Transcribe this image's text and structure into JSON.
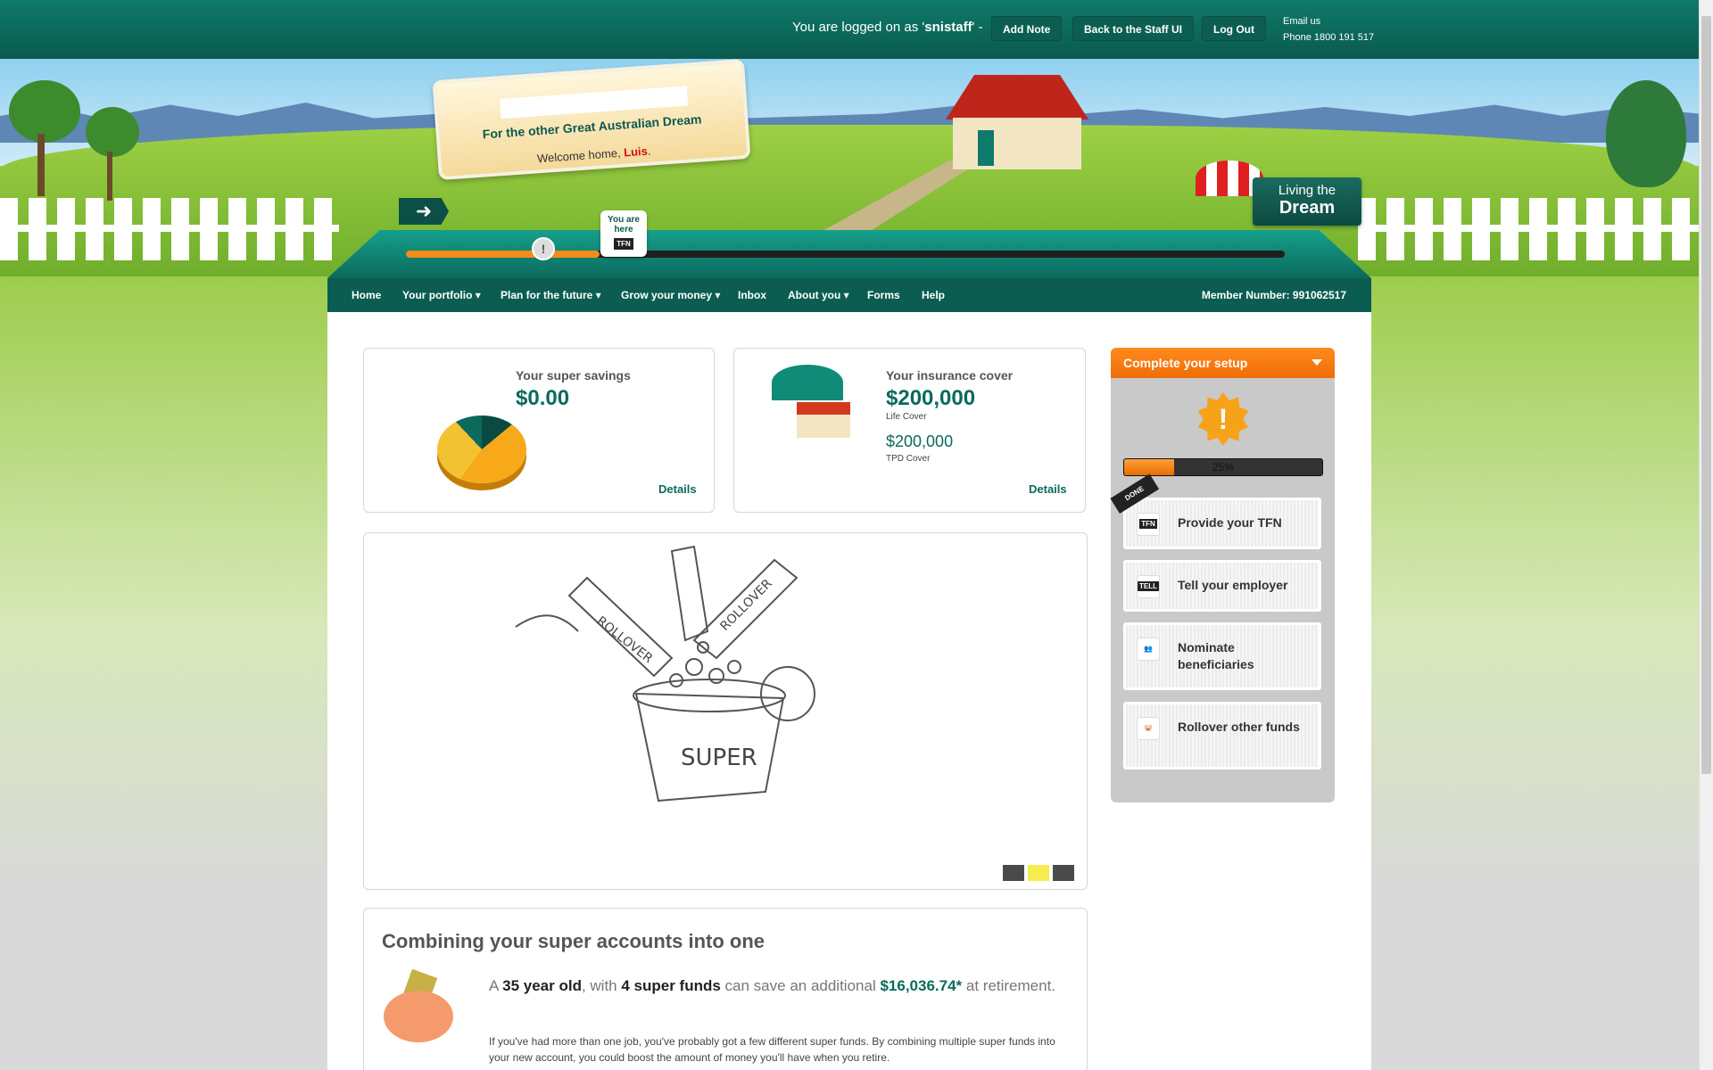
{
  "topbar": {
    "logged_prefix": "You are logged on as '",
    "username": "snistaff",
    "logged_suffix": "' -",
    "add_note": "Add Note",
    "back_staff": "Back to the Staff UI",
    "logout": "Log Out",
    "email": "Email us",
    "phone": "Phone 1800 191 517"
  },
  "hero": {
    "slogan": "For the other Great Australian Dream",
    "welcome_prefix": "Welcome home, ",
    "name": "Luis",
    "welcome_suffix": ".",
    "you_are_here": "You are here",
    "you_are_here_icon": "TFN",
    "dream_line1": "Living the",
    "dream_line2": "Dream",
    "journey_progress": 0.22
  },
  "nav": {
    "items": [
      {
        "label": "Home"
      },
      {
        "label": "Your portfolio ▾"
      },
      {
        "label": "Plan for the future ▾"
      },
      {
        "label": "Grow your money ▾"
      },
      {
        "label": "Inbox"
      },
      {
        "label": "About you ▾"
      },
      {
        "label": "Forms"
      },
      {
        "label": "Help"
      }
    ],
    "member": "Member Number: 991062517"
  },
  "super": {
    "title": "Your super savings",
    "amount": "$0.00",
    "details": "Details"
  },
  "insurance": {
    "title": "Your insurance cover",
    "life_amount": "$200,000",
    "life_label": "Life Cover",
    "tpd_amount": "$200,000",
    "tpd_label": "TPD Cover",
    "details": "Details"
  },
  "slider": {
    "sketch_text": [
      "ROLLOVER",
      "ROLLOVER",
      "SUPER"
    ],
    "active_index": 1
  },
  "combine": {
    "title": "Combining your super accounts into one",
    "stat_a": "A ",
    "stat_age": "35 year old",
    "stat_with": ", with ",
    "stat_funds": "4 super funds",
    "stat_save": " can save an additional ",
    "stat_money": "$16,036.74*",
    "stat_end": " at retirement.",
    "para": "If you've had more than one job, you've probably got a few different super funds. By combining multiple super funds into your new                    account, you could boost the amount of money you'll have when you retire."
  },
  "setup": {
    "title": "Complete your setup",
    "progress_label": "25%",
    "progress": 0.25,
    "done_label": "DONE",
    "steps": [
      {
        "label": "Provide your TFN",
        "icon": "TFN"
      },
      {
        "label": "Tell your employer",
        "icon": "TELL"
      },
      {
        "label": "Nominate beneficiaries",
        "icon": "people-icon"
      },
      {
        "label": "Rollover other funds",
        "icon": "piggy-icon"
      }
    ]
  },
  "colors": {
    "brand_green": "#0b6a5c",
    "accent_orange": "#f06d06"
  }
}
